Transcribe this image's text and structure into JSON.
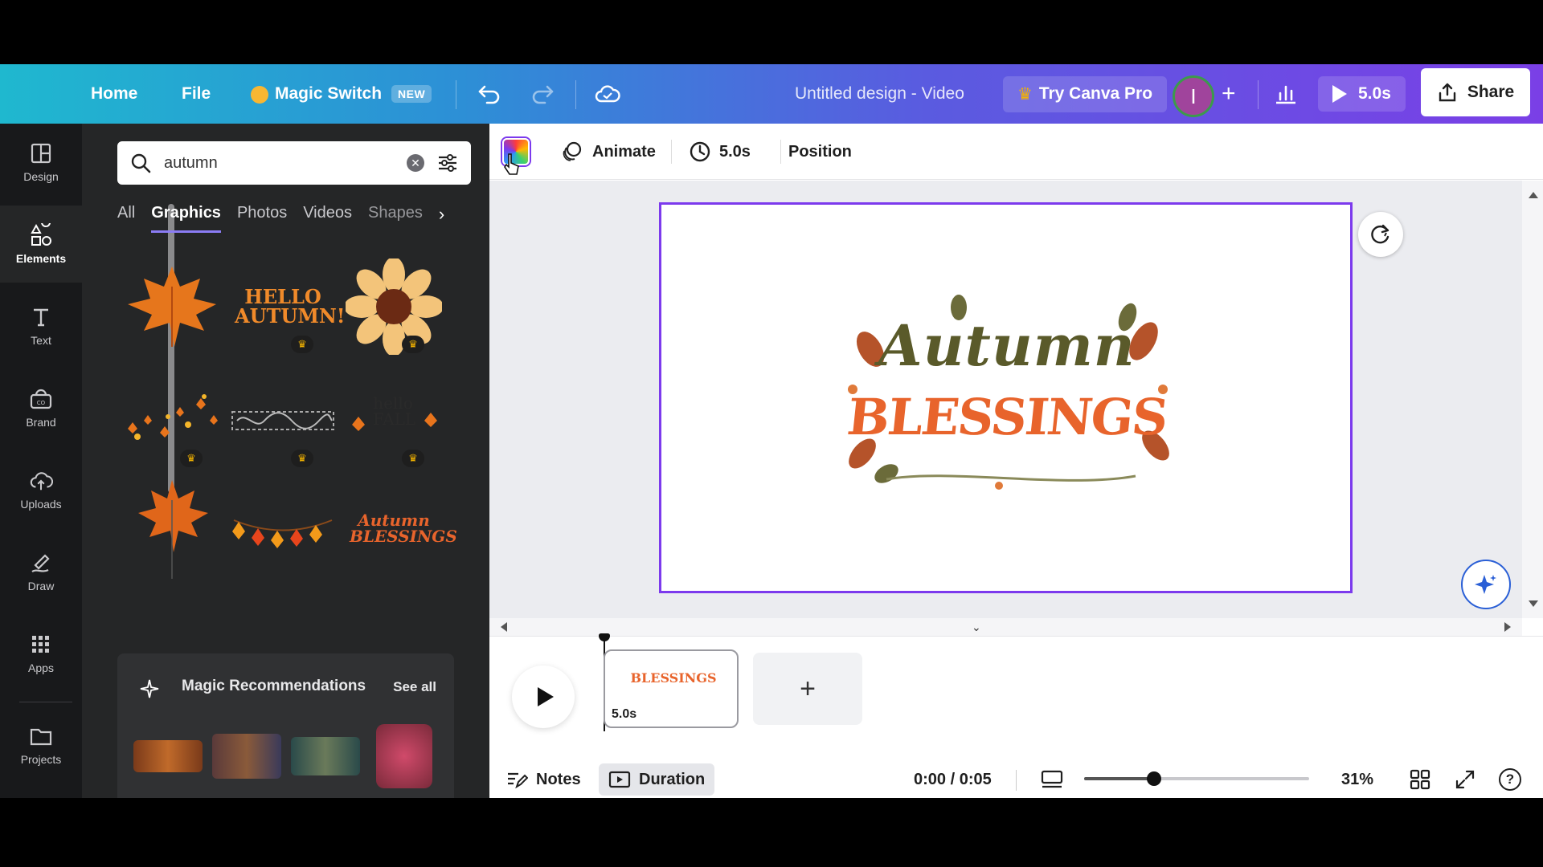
{
  "topbar": {
    "home": "Home",
    "file": "File",
    "magic_switch": "Magic Switch",
    "new_badge": "NEW",
    "title": "Untitled design - Video",
    "try_pro": "Try Canva Pro",
    "avatar_initial": "I",
    "play_duration": "5.0s",
    "share": "Share"
  },
  "rail": {
    "items": [
      {
        "label": "Design",
        "icon": "layout-icon"
      },
      {
        "label": "Elements",
        "icon": "shapes-icon"
      },
      {
        "label": "Text",
        "icon": "text-icon"
      },
      {
        "label": "Brand",
        "icon": "brand-icon"
      },
      {
        "label": "Uploads",
        "icon": "cloud-upload-icon"
      },
      {
        "label": "Draw",
        "icon": "pen-icon"
      },
      {
        "label": "Apps",
        "icon": "apps-grid-icon"
      },
      {
        "label": "Projects",
        "icon": "folder-icon"
      }
    ]
  },
  "panel": {
    "search_value": "autumn",
    "tabs": [
      "All",
      "Graphics",
      "Photos",
      "Videos",
      "Shapes"
    ],
    "graphics": [
      {
        "label": "",
        "premium": false
      },
      {
        "label": "HELLO AUTUMN!",
        "premium": true
      },
      {
        "label": "",
        "premium": true
      },
      {
        "label": "",
        "premium": true
      },
      {
        "label": "",
        "premium": true
      },
      {
        "label": "hello FALL",
        "premium": true
      },
      {
        "label": "",
        "premium": false
      },
      {
        "label": "",
        "premium": false
      },
      {
        "label": "Autumn BLESSINGS",
        "premium": false
      }
    ],
    "magic_title": "Magic Recommendations",
    "see_all": "See all"
  },
  "context_bar": {
    "animate": "Animate",
    "duration": "5.0s",
    "position": "Position"
  },
  "canvas": {
    "artwork_line1": "Autumn",
    "artwork_line2": "BLESSINGS"
  },
  "timeline": {
    "clip_duration": "5.0s",
    "add": "+"
  },
  "bottombar": {
    "notes": "Notes",
    "duration": "Duration",
    "time": "0:00 / 0:05",
    "zoom": "31%",
    "zoom_level": 0.31
  },
  "colors": {
    "accent": "#7c3aed",
    "panel": "#252627",
    "rail": "#18191b",
    "autumn_orange": "#e8642c",
    "autumn_green": "#5a5a2a"
  }
}
